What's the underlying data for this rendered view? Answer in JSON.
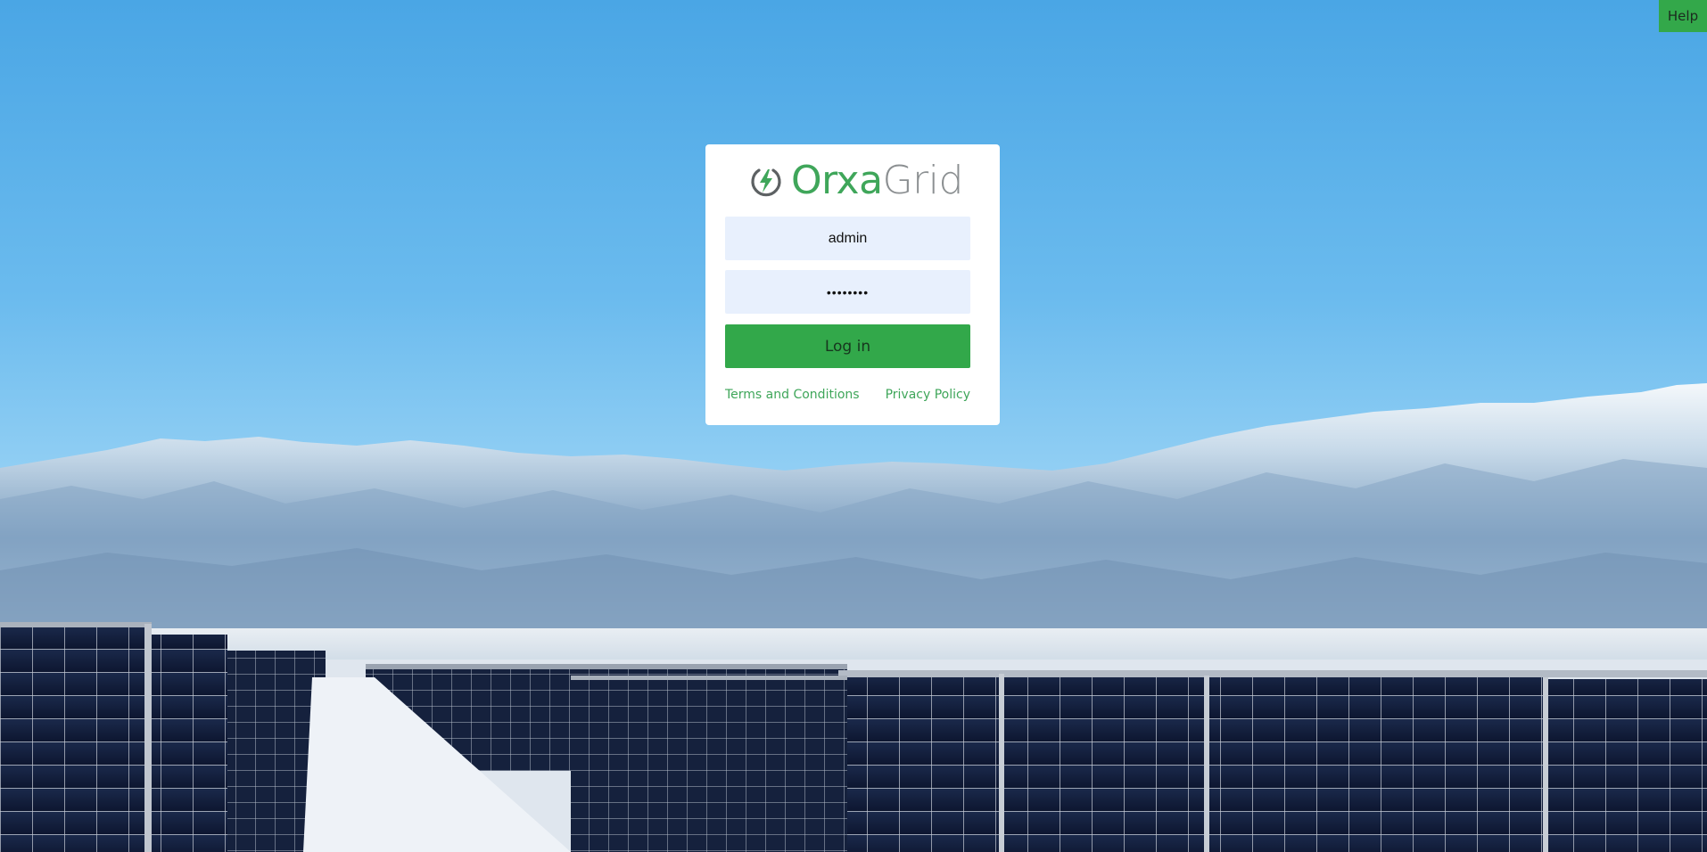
{
  "header": {
    "help_label": "Help"
  },
  "logo": {
    "icon": "power-bolt-icon",
    "word_primary": "Orxa",
    "word_secondary": "Grid",
    "primary_color": "#3fa65a",
    "secondary_color": "#8b8f91"
  },
  "login": {
    "username_value": "admin",
    "password_value": "password",
    "submit_label": "Log in"
  },
  "footer_links": {
    "terms_label": "Terms and Conditions",
    "privacy_label": "Privacy Policy"
  },
  "colors": {
    "accent": "#32a84a",
    "input_bg": "#e8f0fd",
    "sky": "#62b3ea"
  }
}
